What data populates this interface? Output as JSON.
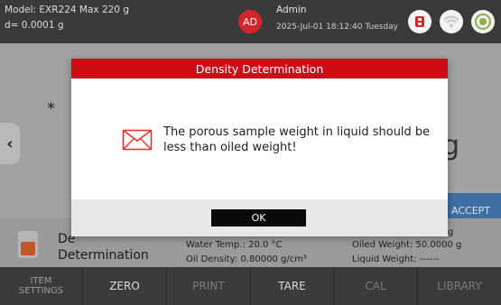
{
  "topbar": {
    "model_line": "Model: EXR224   Max 220 g",
    "d_line": "d= 0.0001 g",
    "avatar_initials": "AD",
    "user": "Admin",
    "datetime": "2025-Jul-01 18:12:40 Tuesday",
    "icons": [
      "usb-icon",
      "wifi-icon",
      "level-icon"
    ],
    "accent_color": "#d4262a"
  },
  "main": {
    "star": "*",
    "left_tab_glyph": "‹",
    "right_digit": "g",
    "accept_label": "ACCEPT"
  },
  "info": {
    "app_name_part1": "De",
    "app_name_part2": "Determination",
    "water_temp": "Water Temp.: 20.0 °C",
    "oil_density": "Oil Density: 0.80000 g/cm³",
    "right_top": "g",
    "oiled_weight": "Oiled Weight: 50.0000 g",
    "liquid_weight": "Liquid Weight: ------"
  },
  "bottombar": {
    "buttons": [
      {
        "label_line1": "ITEM",
        "label_line2": "SETTINGS"
      },
      {
        "label": "ZERO"
      },
      {
        "label": "PRINT"
      },
      {
        "label": "TARE"
      },
      {
        "label": "CAL"
      },
      {
        "label": "LIBRARY"
      }
    ]
  },
  "modal": {
    "title": "Density Determination",
    "message": "The porous sample weight in liquid should be less than oiled weight!",
    "ok_label": "OK",
    "title_color": "#cc0e14",
    "icon": "envelope-icon"
  }
}
